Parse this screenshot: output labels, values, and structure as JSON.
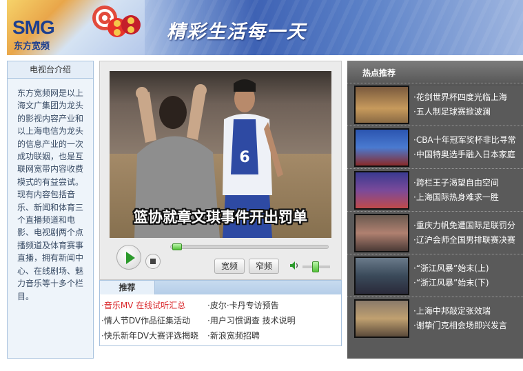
{
  "banner": {
    "logo_text": "SMG",
    "logo_cn": "东方宽频",
    "logo_badge": "@88",
    "slogan": "精彩生活每一天"
  },
  "intro": {
    "title": "电视台介绍",
    "text": "东方宽频网是以上海文广集团为龙头的影视内容产业和以上海电信为龙头的信息产业的一次成功联姻，也是互联网宽带内容收费模式的有益尝试。现有内容包括音乐、新闻和体育三个直播频道和电影、电视剧两个点播频道及体育赛事直播，拥有新闻中心、在线剧场、魅力音乐等十多个栏目。"
  },
  "player": {
    "caption": "篮协就章文琪事件开出罚单",
    "progress": 0.0,
    "volume": 0.5,
    "btn_wide": "宽频",
    "btn_narrow": "窄频"
  },
  "recommend": {
    "title": "推荐",
    "items": [
      "·音乐MV 在线试听汇总",
      "·皮尔·卡丹专访预告",
      "·情人节DV作品征集活动",
      "·用户习惯调查 技术说明",
      "·快乐新年DV大赛评选揭晓",
      "·新浪宽频招聘"
    ]
  },
  "hot": {
    "title": "热点推荐",
    "rows": [
      {
        "l1": "·花剑世界杯四度光临上海",
        "l2": "·五人制足球赛掀波澜"
      },
      {
        "l1": "·CBA十年冠军奖杯非比寻常",
        "l2": "·中国特奥选手融入日本家庭"
      },
      {
        "l1": "·跨栏王子渴望自由空间",
        "l2": "·上海国际热身难求一胜"
      },
      {
        "l1": "·重庆力帆免遭国际足联罚分",
        "l2": "·辽沪会师全国男排联赛决赛"
      },
      {
        "l1": "·“浙江风暴”始末(上)",
        "l2": "·“浙江风暴”始末(下)"
      },
      {
        "l1": "·上海中邦敲定张效瑞",
        "l2": "·谢挚门克相会场即兴发言"
      }
    ]
  }
}
